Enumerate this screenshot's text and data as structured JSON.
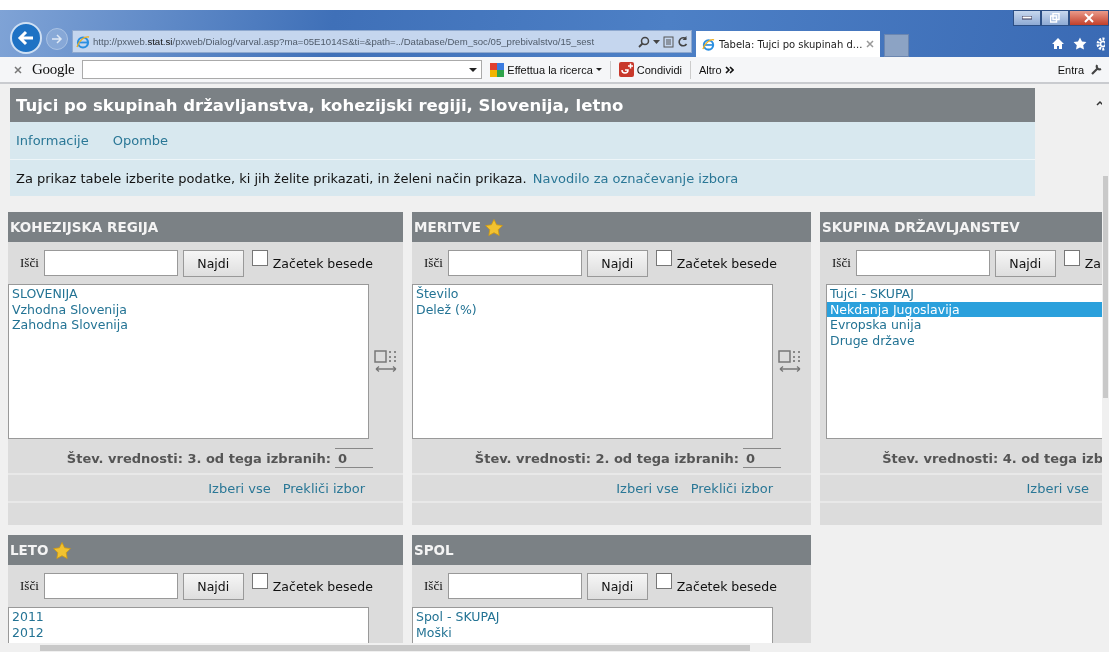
{
  "browser": {
    "url": "http://pxweb.**stat.si**/pxweb/Dialog/varval.asp?ma=05E1014S&ti=&path=../Database/Dem_soc/05_prebivalstvo/15_sest",
    "tabs": [
      {
        "title": "Tabela: Tujci po skupinah d...",
        "selected": true
      }
    ],
    "toolbar": {
      "logo": "Google",
      "search_button": "Effettua la ricerca",
      "share_button": "Condividi",
      "more_button": "Altro",
      "sign_in": "Entra"
    }
  },
  "page": {
    "title": "Tujci po skupinah državljanstva, kohezijski regiji, Slovenija, letno",
    "nav_links": [
      "Informacije",
      "Opombe"
    ],
    "instruction": "Za prikaz tabele izberite podatke, ki jih želite prikazati, in želeni način prikaza.",
    "help_link": "Navodilo za označevanje izbora"
  },
  "panels": [
    {
      "title": "KOHEZIJSKA REGIJA",
      "starred": false,
      "search_label": "Išči",
      "find_button": "Najdi",
      "checkbox_label": "Začetek besede",
      "checked": false,
      "items": [
        {
          "label": "SLOVENIJA",
          "selected": false
        },
        {
          "label": "Vzhodna Slovenija",
          "selected": false
        },
        {
          "label": "Zahodna Slovenija",
          "selected": false
        }
      ],
      "stats": "Štev. vrednosti: 3. od tega izbranih:",
      "selected_count": "0",
      "links": [
        "Izberi vse",
        "Prekliči izbor"
      ]
    },
    {
      "title": "MERITVE",
      "starred": true,
      "search_label": "Išči",
      "find_button": "Najdi",
      "checkbox_label": "Začetek besede",
      "checked": false,
      "items": [
        {
          "label": "Število",
          "selected": false
        },
        {
          "label": "Delež (%)",
          "selected": false
        }
      ],
      "stats": "Štev. vrednosti: 2. od tega izbranih:",
      "selected_count": "0",
      "links": [
        "Izberi vse",
        "Prekliči izbor"
      ]
    },
    {
      "title": "SKUPINA DRŽAVLJANSTEV",
      "starred": false,
      "search_label": "Išči",
      "find_button": "Najdi",
      "checkbox_label": "Za",
      "checked": false,
      "items": [
        {
          "label": "Tujci - SKUPAJ",
          "selected": false
        },
        {
          "label": "Nekdanja Jugoslavija",
          "selected": true
        },
        {
          "label": "Evropska unija",
          "selected": false
        },
        {
          "label": "Druge države",
          "selected": false
        }
      ],
      "stats": "Štev. vrednosti: 4. od tega izb",
      "links": [
        "Izberi vse"
      ]
    },
    {
      "title": "LETO",
      "starred": true,
      "search_label": "Išči",
      "find_button": "Najdi",
      "checkbox_label": "Začetek besede",
      "checked": false,
      "items": [
        {
          "label": "2011",
          "selected": false
        },
        {
          "label": "2012",
          "selected": false
        }
      ]
    },
    {
      "title": "SPOL",
      "starred": false,
      "search_label": "Išči",
      "find_button": "Najdi",
      "checkbox_label": "Začetek besede",
      "checked": false,
      "items": [
        {
          "label": "Spol - SKUPAJ",
          "selected": false
        },
        {
          "label": "Moški",
          "selected": false
        }
      ]
    }
  ]
}
